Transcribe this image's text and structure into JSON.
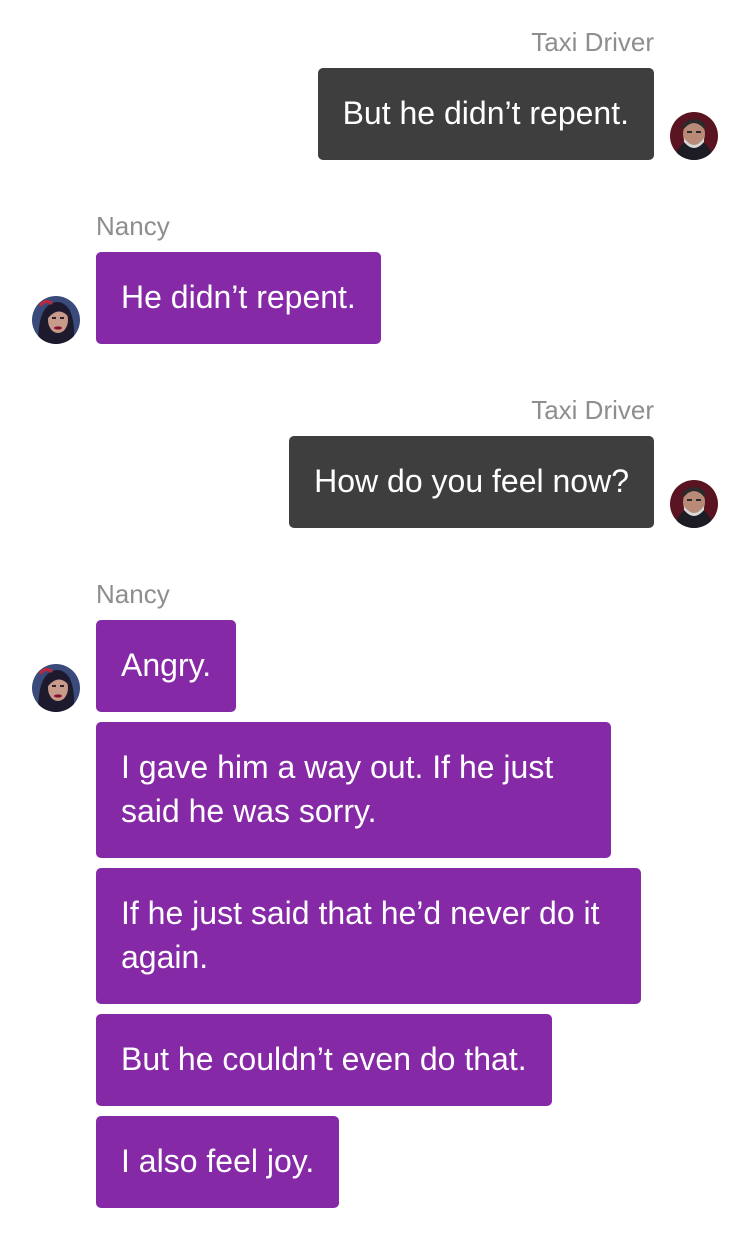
{
  "conversation": {
    "messages": [
      {
        "sender": "Taxi Driver",
        "text": "But he didn’t repent."
      },
      {
        "sender": "Nancy",
        "text": "He didn’t repent."
      },
      {
        "sender": "Taxi Driver",
        "text": "How do you feel now?"
      },
      {
        "sender": "Nancy",
        "text": "Angry."
      },
      {
        "sender": "Nancy",
        "text": "I gave him a way out. If he just said he was sorry."
      },
      {
        "sender": "Nancy",
        "text": "If he just said that he’d never do it again."
      },
      {
        "sender": "Nancy",
        "text": "But he couldn’t even do that."
      },
      {
        "sender": "Nancy",
        "text": "I also feel joy."
      }
    ]
  },
  "colors": {
    "outgoing_bubble": "#3e3e3e",
    "incoming_bubble": "#8629a6",
    "sender_name": "#8e8e8e",
    "bubble_text": "#ffffff"
  },
  "icons": {
    "driver_avatar": "taxi-driver-avatar-icon",
    "nancy_avatar": "nancy-avatar-icon"
  }
}
